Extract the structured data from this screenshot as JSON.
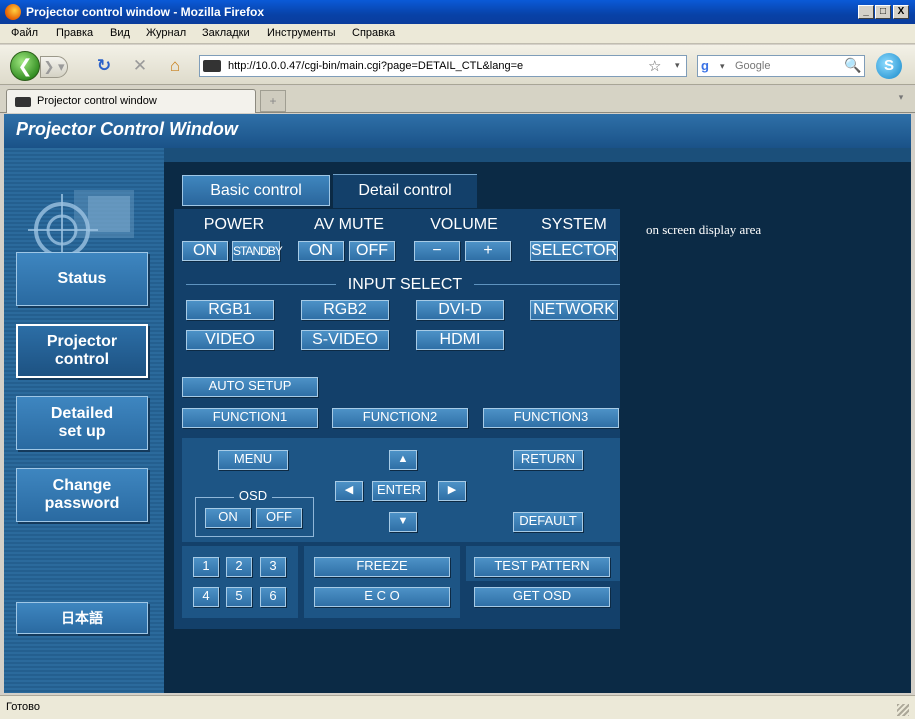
{
  "window": {
    "title": "Projector control window - Mozilla Firefox",
    "min": "_",
    "max": "□",
    "close": "X"
  },
  "menu": [
    "Файл",
    "Правка",
    "Вид",
    "Журнал",
    "Закладки",
    "Инструменты",
    "Справка"
  ],
  "nav": {
    "url": "http://10.0.0.47/cgi-bin/main.cgi?page=DETAIL_CTL&lang=e",
    "search_placeholder": "Google"
  },
  "tab": {
    "title": "Projector control window"
  },
  "page": {
    "header": "Projector Control Window",
    "sidebar": [
      {
        "label": "Status",
        "active": false
      },
      {
        "label": "Projector\ncontrol",
        "active": true
      },
      {
        "label": "Detailed\nset up",
        "active": false
      },
      {
        "label": "Change\npassword",
        "active": false
      },
      {
        "label": "日本語",
        "active": false
      }
    ],
    "tabs": {
      "basic": "Basic control",
      "detail": "Detail control"
    },
    "power": {
      "label": "POWER",
      "on": "ON",
      "standby": "STANDBY"
    },
    "avmute": {
      "label": "AV MUTE",
      "on": "ON",
      "off": "OFF"
    },
    "volume": {
      "label": "VOLUME",
      "minus": "−",
      "plus": "+"
    },
    "system": {
      "label": "SYSTEM",
      "selector": "SELECTOR"
    },
    "input_select": {
      "label": "INPUT SELECT",
      "items": [
        "RGB1",
        "RGB2",
        "DVI-D",
        "NETWORK",
        "VIDEO",
        "S-VIDEO",
        "HDMI"
      ]
    },
    "auto_setup": "AUTO SETUP",
    "functions": [
      "FUNCTION1",
      "FUNCTION2",
      "FUNCTION3"
    ],
    "menu_btn": "MENU",
    "return_btn": "RETURN",
    "enter_btn": "ENTER",
    "default_btn": "DEFAULT",
    "osd": {
      "label": "OSD",
      "on": "ON",
      "off": "OFF"
    },
    "numbers": [
      "1",
      "2",
      "3",
      "4",
      "5",
      "6"
    ],
    "freeze": "FREEZE",
    "eco": "E C O",
    "test_pattern": "TEST PATTERN",
    "get_osd": "GET OSD",
    "osd_display": "on screen display area"
  },
  "status": "Готово"
}
